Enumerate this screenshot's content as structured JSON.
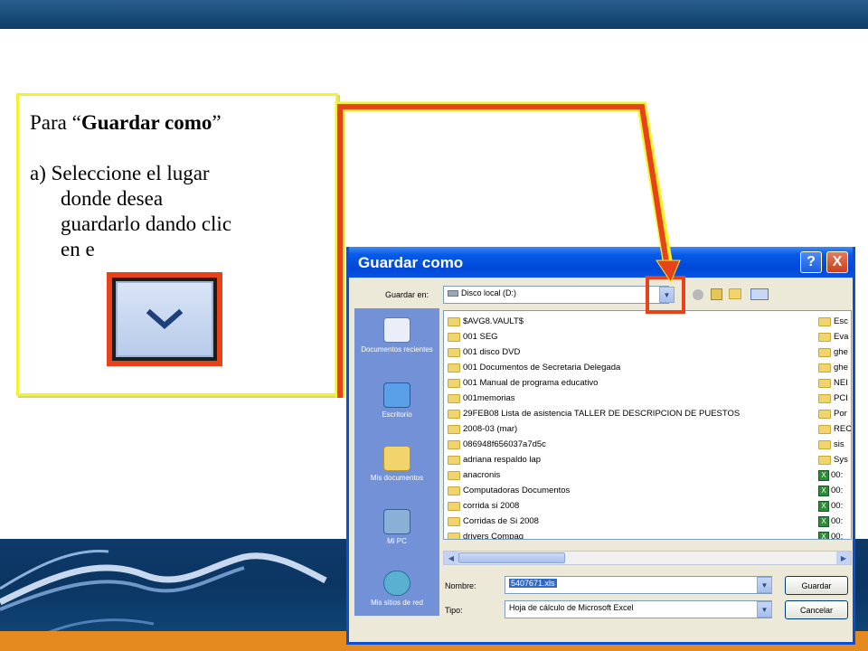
{
  "callout": {
    "line1_prefix": "Para “",
    "line1_bold": "Guardar como",
    "line1_suffix": "”",
    "step_a": "a) Seleccione el lugar",
    "step_a_2": "donde  desea",
    "step_a_3": "guardarlo dando clic",
    "step_a_4": "en e"
  },
  "dialog": {
    "title": "Guardar como",
    "help_glyph": "?",
    "close_glyph": "X",
    "location_label": "Guardar en:",
    "location_value": "Disco local (D:)",
    "places": [
      {
        "label": "Documentos recientes",
        "icon": "recent-documents-icon"
      },
      {
        "label": "Escritorio",
        "icon": "desktop-icon"
      },
      {
        "label": "Mis documentos",
        "icon": "my-documents-icon"
      },
      {
        "label": "Mi PC",
        "icon": "my-computer-icon"
      },
      {
        "label": "Mis sitios de red",
        "icon": "network-places-icon"
      }
    ],
    "files": [
      "$AVG8.VAULT$",
      "001  SEG",
      "001 disco DVD",
      "001 Documentos de Secretaria Delegada",
      "001 Manual de programa educativo",
      "001memorias",
      "29FEB08 Lista de asistencia TALLER DE DESCRIPCION DE PUESTOS",
      "2008-03 (mar)",
      "086948f656037a7d5c",
      "adriana respaldo lap",
      "anacronis",
      "Computadoras Documentos",
      "corrida si 2008",
      "Corridas de Si 2008",
      "drivers Compaq"
    ],
    "right_files": [
      "Esc",
      "Eva",
      "ghe",
      "ghe",
      "NEI",
      "PCI",
      "Por",
      "REC",
      "sis",
      "Sys",
      "00:",
      "00:",
      "00:",
      "00:",
      "00:"
    ],
    "name_label": "Nombre:",
    "name_value": "5407671.xls",
    "type_label": "Tipo:",
    "type_value": "Hoja de cálculo de Microsoft Excel",
    "save_button": "Guardar",
    "cancel_button": "Cancelar"
  },
  "colors": {
    "highlight": "#e8421a",
    "callout_border": "#f4f22a",
    "title_bar": "#0a5ae8"
  }
}
